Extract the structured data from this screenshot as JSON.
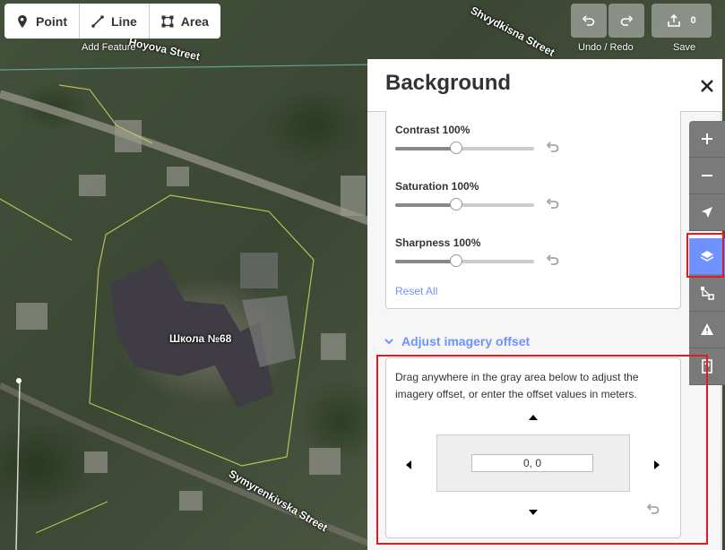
{
  "map": {
    "streets": [
      "Shvydkisna Street",
      "Symyrenkivska Street",
      "Hoyova Street"
    ],
    "poi_label": "Школа №68"
  },
  "toolbar": {
    "point_label": "Point",
    "line_label": "Line",
    "area_label": "Area",
    "add_feature_caption": "Add Feature",
    "undo_redo_caption": "Undo / Redo",
    "save_caption": "Save",
    "save_count": "0"
  },
  "panel": {
    "title": "Background",
    "contrast_label": "Contrast 100%",
    "saturation_label": "Saturation 100%",
    "sharpness_label": "Sharpness 100%",
    "contrast_value": 1.0,
    "saturation_value": 1.0,
    "sharpness_value": 1.0,
    "reset_all": "Reset All",
    "offset_section_title": "Adjust imagery offset",
    "offset_instructions": "Drag anywhere in the gray area below to adjust the imagery offset, or enter the offset values in meters.",
    "offset_value": "0, 0"
  },
  "colors": {
    "accent": "#7092ff",
    "highlight": "#e01b24",
    "control_gray": "#7a7a7a"
  },
  "icons": [
    "point-icon",
    "line-icon",
    "area-icon",
    "undo-icon",
    "redo-icon",
    "upload-icon",
    "zoom-in-icon",
    "zoom-out-icon",
    "locate-icon",
    "layers-icon",
    "map-data-icon",
    "issues-icon",
    "help-icon",
    "close-icon",
    "reset-icon",
    "chevron-down-icon"
  ]
}
